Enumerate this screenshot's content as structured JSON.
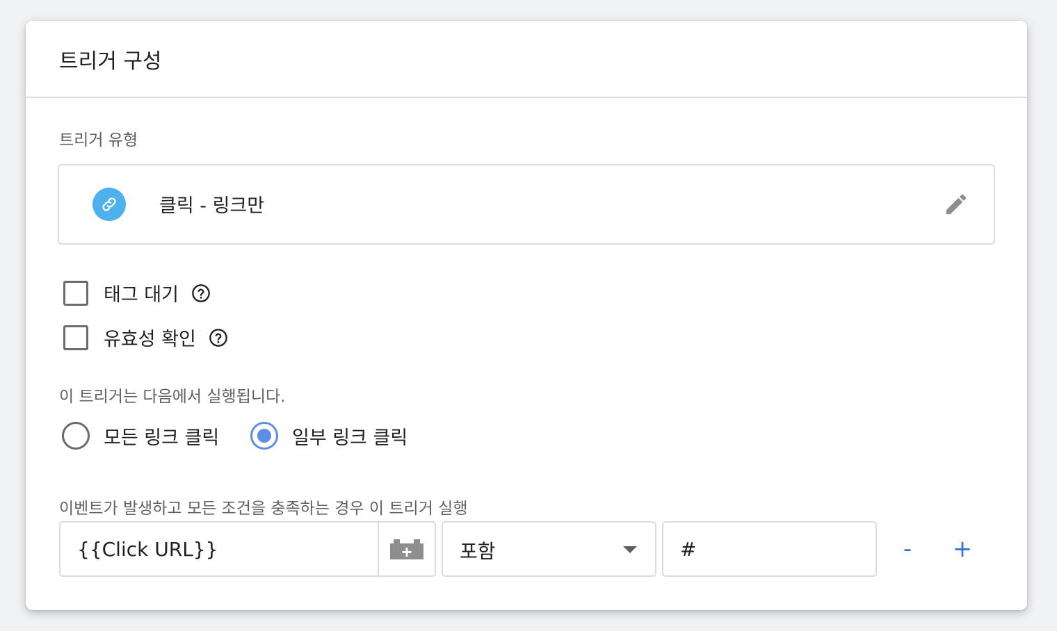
{
  "card": {
    "title": "트리거 구성"
  },
  "trigger_type": {
    "label": "트리거 유형",
    "name": "클릭 - 링크만",
    "icon": "link-icon",
    "icon_color": "#4fb0ee"
  },
  "options": {
    "wait_for_tags": {
      "label": "태그 대기",
      "checked": false
    },
    "check_validation": {
      "label": "유효성 확인",
      "checked": false
    }
  },
  "fires_on": {
    "label": "이 트리거는 다음에서 실행됩니다.",
    "all_clicks": {
      "label": "모든 링크 클릭",
      "selected": false
    },
    "some_clicks": {
      "label": "일부 링크 클릭",
      "selected": true
    }
  },
  "condition": {
    "label": "이벤트가 발생하고 모든 조건을 충족하는 경우 이 트리거 실행",
    "variable": "{{Click URL}}",
    "operator": "포함",
    "value": "#",
    "remove_label": "-",
    "add_label": "+"
  },
  "colors": {
    "accent": "#5c8ee6",
    "action_blue": "#3a73d6"
  }
}
